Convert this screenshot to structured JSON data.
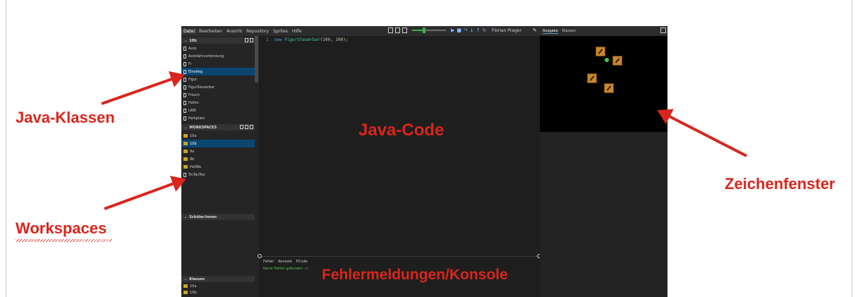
{
  "menubar": {
    "items": [
      "Datei",
      "Bearbeiten",
      "Ansicht",
      "Repository",
      "Sprites",
      "Hilfe"
    ]
  },
  "toolbar": {
    "user": "Florian Prager",
    "speed_fraction": 0.35
  },
  "sidebar": {
    "files_header": "10b",
    "files": [
      "Auto",
      "Autofahrverbindung",
      "Fi",
      "Einstieg",
      "Figur",
      "FigurSteuerbar",
      "Frosch",
      "Hafen",
      "LKW",
      "Parkplatz"
    ],
    "workspaces_header": "WORKSPACES",
    "workspaces": [
      "10a",
      "10b",
      "9a",
      "9b",
      "HelWa",
      "TicTacToe"
    ],
    "students_header": "Schüler/innen",
    "classes_header": "Klassen",
    "classes": [
      "10a",
      "10b"
    ]
  },
  "editor": {
    "line_number": "1",
    "keyword": "new",
    "class_name": "FigurSteuerbar",
    "args_open": "(",
    "arg1": "100",
    "sep": ", ",
    "arg2": "100",
    "args_close": ");"
  },
  "bottom": {
    "tabs": [
      "Fehler",
      "Konsole",
      "PCode"
    ],
    "status": "Keine Fehler gefunden :-)"
  },
  "right_panel": {
    "tabs": [
      "Ausgabe",
      "Klassen"
    ]
  },
  "annotations": {
    "java_klassen": "Java-Klassen",
    "workspaces": "Workspaces",
    "java_code": "Java-Code",
    "fehler": "Fehlermeldungen/Konsole",
    "zeichenfenster": "Zeichenfenster"
  },
  "colors": {
    "annotation_red": "#d9261c",
    "selection": "#094771",
    "canvas": "#000000"
  }
}
